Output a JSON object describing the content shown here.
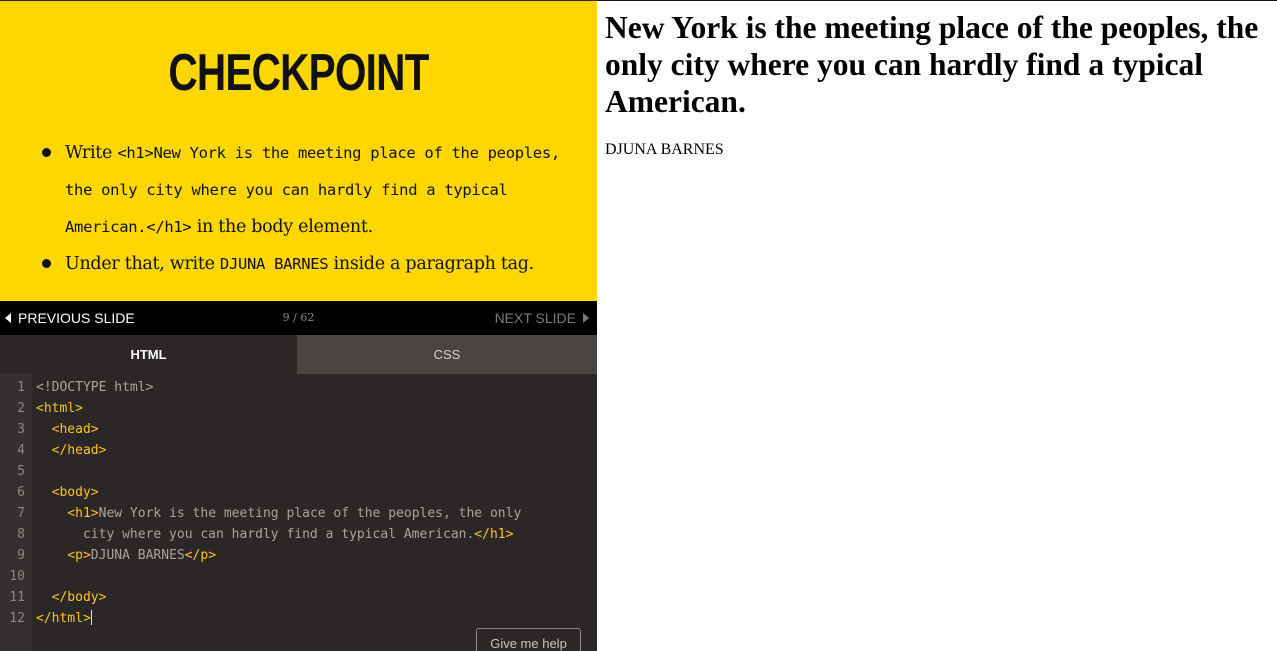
{
  "checkpoint": {
    "title": "CHECKPOINT",
    "instructions": [
      {
        "pre": "Write ",
        "code": "<h1>New York is the meeting place of the peoples, the only city where you can hardly find a typical American.</h1>",
        "post": " in the body element."
      },
      {
        "pre": "Under that, write ",
        "code": "DJUNA BARNES",
        "post": " inside a paragraph tag."
      }
    ]
  },
  "slide_nav": {
    "previous_label": "PREVIOUS SLIDE",
    "next_label": "NEXT SLIDE",
    "counter": "9 / 62"
  },
  "tabs": [
    {
      "label": "HTML",
      "active": true
    },
    {
      "label": "CSS",
      "active": false
    }
  ],
  "editor": {
    "lines": [
      {
        "num": "1",
        "segments": [
          {
            "t": "doctype",
            "v": "<!DOCTYPE html>"
          }
        ]
      },
      {
        "num": "2",
        "segments": [
          {
            "t": "tag",
            "v": "<html>"
          }
        ]
      },
      {
        "num": "3",
        "segments": [
          {
            "t": "txt",
            "v": "  "
          },
          {
            "t": "tag",
            "v": "<head>"
          }
        ]
      },
      {
        "num": "4",
        "segments": [
          {
            "t": "txt",
            "v": "  "
          },
          {
            "t": "tag",
            "v": "</head>"
          }
        ]
      },
      {
        "num": "5",
        "segments": []
      },
      {
        "num": "6",
        "segments": [
          {
            "t": "txt",
            "v": "  "
          },
          {
            "t": "tag",
            "v": "<body>"
          }
        ]
      },
      {
        "num": "7",
        "segments": [
          {
            "t": "txt",
            "v": "    "
          },
          {
            "t": "tag",
            "v": "<h1>"
          },
          {
            "t": "txt",
            "v": "New York is the meeting place of the peoples, the only"
          }
        ]
      },
      {
        "num": "8",
        "segments": [
          {
            "t": "txt",
            "v": "      city where you can hardly find a typical American."
          },
          {
            "t": "tag",
            "v": "</h1>"
          }
        ]
      },
      {
        "num": "9",
        "segments": [
          {
            "t": "txt",
            "v": "    "
          },
          {
            "t": "tag",
            "v": "<p>"
          },
          {
            "t": "txt",
            "v": "DJUNA BARNES"
          },
          {
            "t": "tag",
            "v": "</p>"
          }
        ]
      },
      {
        "num": "10",
        "segments": []
      },
      {
        "num": "11",
        "segments": [
          {
            "t": "txt",
            "v": "  "
          },
          {
            "t": "tag",
            "v": "</body>"
          }
        ]
      },
      {
        "num": "12",
        "segments": [
          {
            "t": "tag",
            "v": "</html>"
          }
        ]
      }
    ],
    "help_button": "Give me help"
  },
  "preview": {
    "heading": "New York is the meeting place of the peoples, the only city where you can hardly find a typical American.",
    "paragraph": "DJUNA BARNES"
  },
  "colors": {
    "checkpoint_bg": "#fed700",
    "editor_bg": "#2a2726",
    "tag_color": "#fec418"
  }
}
